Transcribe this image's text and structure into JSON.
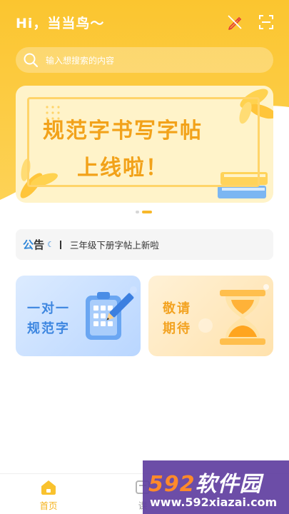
{
  "header": {
    "greeting": "Hi，当当鸟～",
    "search_placeholder": "输入想搜索的内容"
  },
  "banner": {
    "line1": "规范字书写字帖",
    "line2": "上线啦！",
    "active_slide": 2,
    "slide_count": 2
  },
  "notice": {
    "tag_part1": "公",
    "tag_part2": "告",
    "wave": "☾",
    "text": "三年级下册字帖上新啦"
  },
  "cards": [
    {
      "line1": "一对一",
      "line2": "规范字"
    },
    {
      "line1": "敬请",
      "line2": "期待"
    }
  ],
  "tabbar": {
    "items": [
      {
        "label": "首页",
        "active": true
      },
      {
        "label": "课",
        "active": false
      }
    ]
  },
  "watermark": {
    "num": "592",
    "brand": "软件园",
    "url": "www.592xiazai.com"
  },
  "colors": {
    "brand_yellow": "#f9c22e",
    "banner_text": "#f2a21a",
    "notice_blue": "#2f86d8",
    "card_blue": "#3d86e0",
    "card_orange": "#f3a322"
  },
  "icons": {
    "header_left": "pencil-off-icon",
    "header_right": "scan-icon",
    "search": "search-icon",
    "card_left": "clipboard-pencil-icon",
    "card_right": "hourglass-icon",
    "tab_home": "home-icon",
    "tab_course": "course-icon"
  }
}
